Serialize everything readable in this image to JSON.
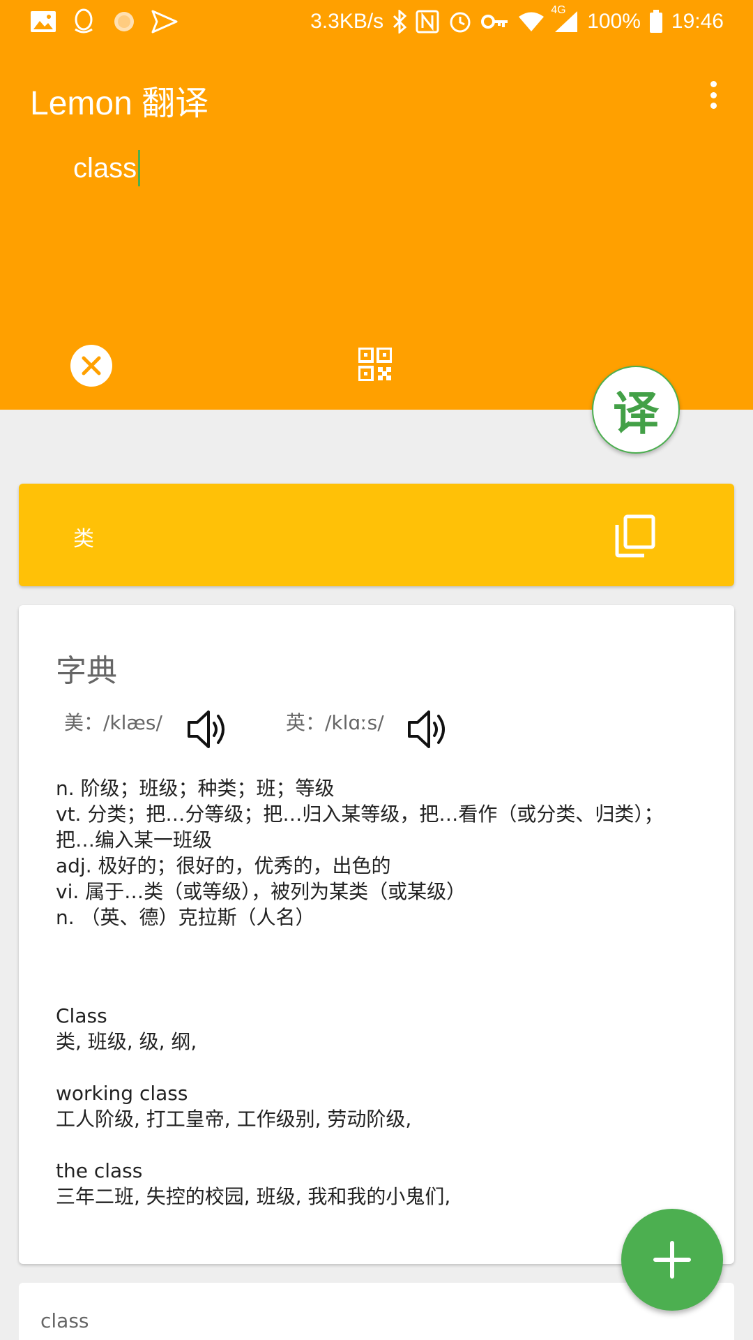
{
  "status_bar": {
    "net_speed": "3.3KB/s",
    "network": "4G",
    "battery": "100%",
    "time": "19:46",
    "icons": [
      "gallery-icon",
      "qq-icon",
      "sun-icon",
      "send-icon",
      "bluetooth-icon",
      "nfc-icon",
      "alarm-icon",
      "vpn-key-icon",
      "wifi-icon",
      "signal-icon",
      "battery-icon"
    ]
  },
  "app_bar": {
    "title": "Lemon 翻译",
    "menu_icon": "more-vert-icon"
  },
  "input": {
    "value": "class"
  },
  "actions": {
    "clear_icon": "clear-icon",
    "qr_icon": "qr-code-icon",
    "translate_label": "译"
  },
  "result": {
    "text": "类",
    "copy_icon": "copy-icon"
  },
  "dictionary": {
    "title": "字典",
    "us_phonetic": "美：/klæs/",
    "uk_phonetic": "英：/klɑːs/",
    "definitions": [
      "n. 阶级；班级；种类；班；等级",
      "vt. 分类；把…分等级；把…归入某等级，把…看作（或分类、归类）；把…编入某一班级",
      "adj. 极好的；很好的，优秀的，出色的",
      "vi. 属于…类（或等级），被列为某类（或某级）",
      "n. （英、德）克拉斯（人名）"
    ],
    "phrases": [
      {
        "term": "Class",
        "meaning": "类, 班级, 级, 纲,"
      },
      {
        "term": "working class",
        "meaning": "工人阶级, 打工皇帝, 工作级别, 劳动阶级,"
      },
      {
        "term": "the class",
        "meaning": "三年二班, 失控的校园, 班级, 我和我的小鬼们,"
      }
    ]
  },
  "next_card": {
    "text": "class"
  },
  "colors": {
    "primary": "#ffa000",
    "result_card": "#ffc107",
    "accent": "#4caf50",
    "background": "#eeeeee"
  }
}
